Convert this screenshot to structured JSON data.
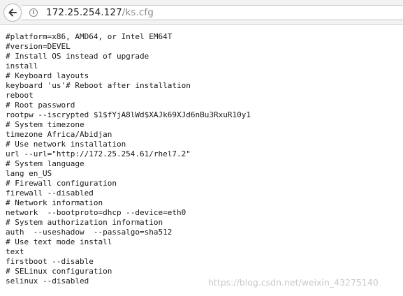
{
  "address_bar": {
    "host": "172.25.254.127",
    "path": "/ks.cfg"
  },
  "icons": {
    "back": "back-arrow-icon",
    "info": "info-icon"
  },
  "file_lines": [
    "#platform=x86, AMD64, or Intel EM64T",
    "#version=DEVEL",
    "# Install OS instead of upgrade",
    "install",
    "# Keyboard layouts",
    "keyboard 'us'# Reboot after installation",
    "reboot",
    "# Root password",
    "rootpw --iscrypted $1$fYjA8lWd$XAJk69XJd6nBu3RxuR10y1",
    "# System timezone",
    "timezone Africa/Abidjan",
    "# Use network installation",
    "url --url=\"http://172.25.254.61/rhel7.2\"",
    "# System language",
    "lang en_US",
    "# Firewall configuration",
    "firewall --disabled",
    "# Network information",
    "network  --bootproto=dhcp --device=eth0",
    "# System authorization information",
    "auth  --useshadow  --passalgo=sha512",
    "# Use text mode install",
    "text",
    "firstboot --disable",
    "# SELinux configuration",
    "selinux --disabled"
  ],
  "watermark": "https://blog.csdn.net/weixin_43275140"
}
